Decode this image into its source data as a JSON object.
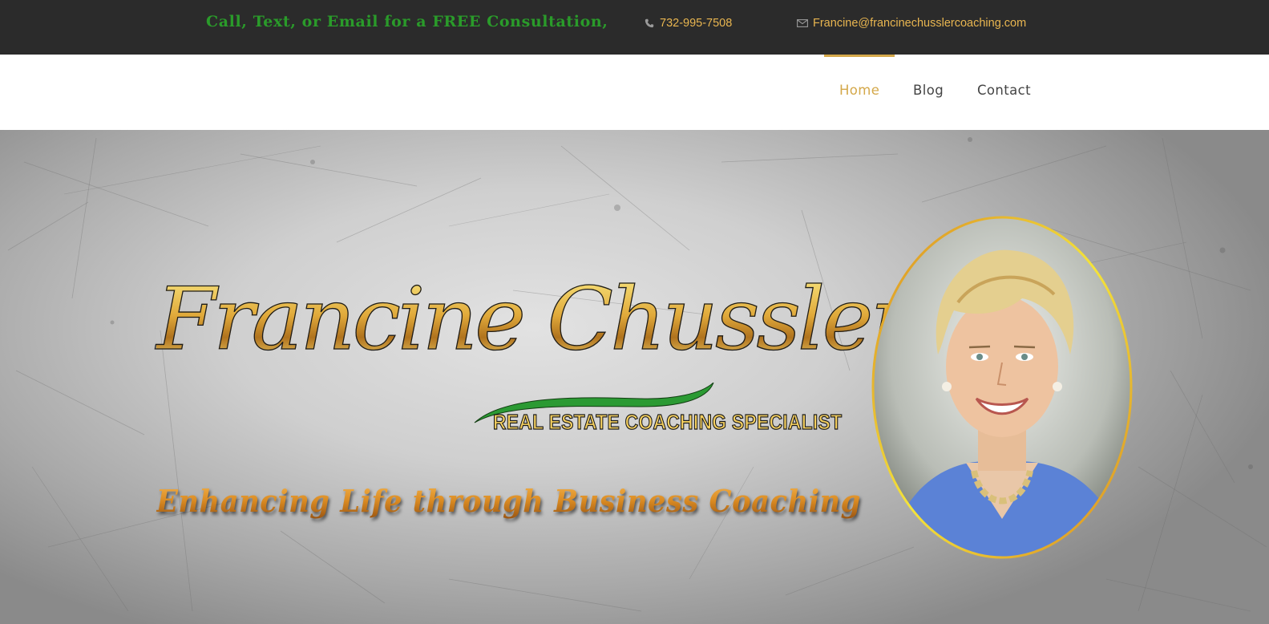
{
  "topbar": {
    "promo_text": "Call, Text, or Email for a FREE Consultation,",
    "phone": "732-995-7508",
    "email": "Francine@francinechusslercoaching.com",
    "phone_icon": "phone-icon",
    "email_icon": "envelope-icon"
  },
  "nav": {
    "items": [
      {
        "label": "Home",
        "active": true
      },
      {
        "label": "Blog",
        "active": false
      },
      {
        "label": "Contact",
        "active": false
      }
    ]
  },
  "hero": {
    "logo_name": "Francine Chussler",
    "logo_subtitle": "REAL ESTATE COACHING SPECIALIST",
    "tagline": "Enhancing Life through Business Coaching"
  },
  "colors": {
    "topbar_bg": "#2b2b2b",
    "promo_green": "#2a9b2a",
    "contact_gold": "#e9b650",
    "nav_active": "#d4a84a",
    "nav_text": "#444444",
    "swoosh_green": "#2b9a33",
    "portrait_shirt": "#5b82d6"
  }
}
